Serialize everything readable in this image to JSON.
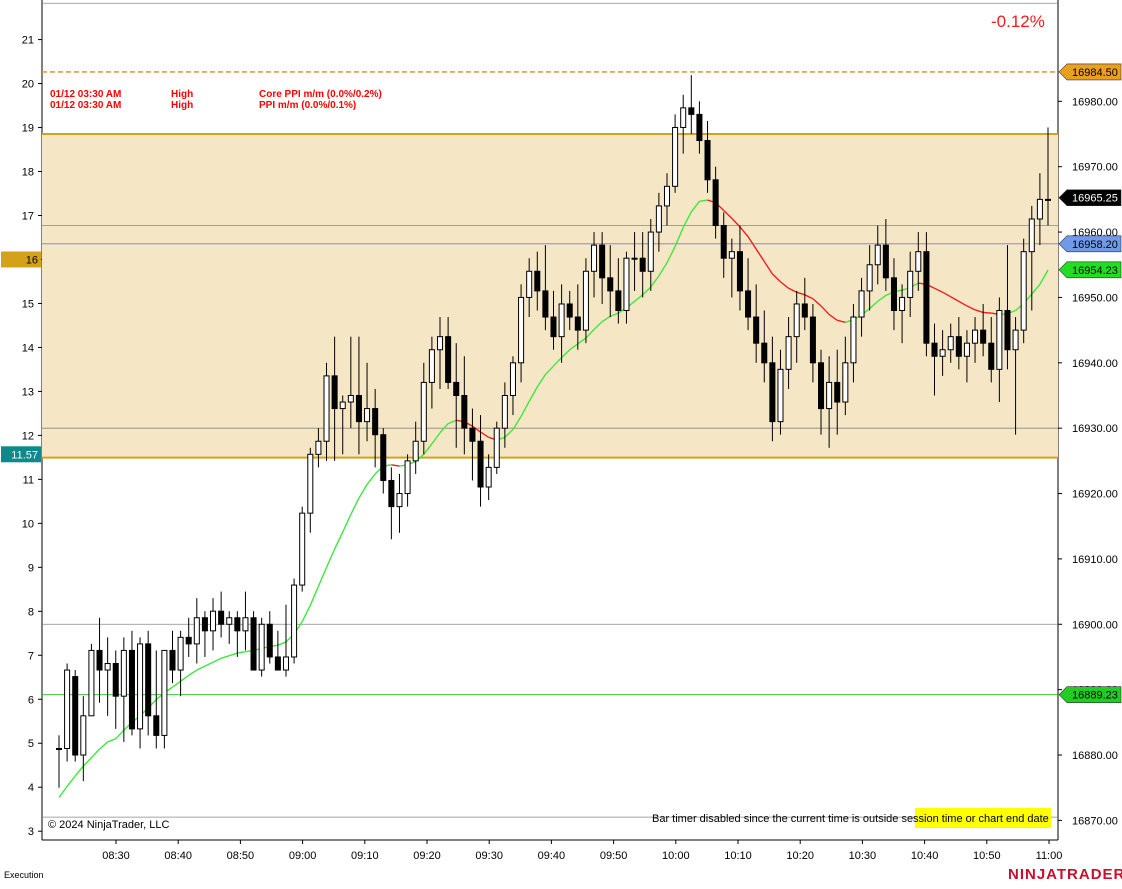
{
  "chart_data": {
    "type": "candlestick",
    "percent_change": "-0.12%",
    "copyright": "© 2024 NinjaTrader, LLC",
    "status_message": "Bar timer disabled since the current time is outside session time or chart end date",
    "status_badge": "Bar timer disabled since the current time is outside session time or chart end date",
    "panel_label": "Execution",
    "brand": "NINJATRADER",
    "x_ticks": [
      "08:30",
      "08:40",
      "08:50",
      "09:00",
      "09:10",
      "09:20",
      "09:30",
      "09:40",
      "09:50",
      "10:00",
      "10:10",
      "10:20",
      "10:30",
      "10:40",
      "10:50",
      "11:00"
    ],
    "left_axis": {
      "ticks": [
        3,
        4,
        5,
        6,
        7,
        8,
        9,
        10,
        11,
        12,
        13,
        14,
        15,
        16,
        17,
        18,
        19,
        20,
        21
      ],
      "range": [
        2.8,
        21.9
      ]
    },
    "right_axis": {
      "ticks": [
        16870,
        16880,
        16890,
        16900,
        16910,
        16920,
        16930,
        16940,
        16950,
        16960,
        16970,
        16980
      ],
      "range": [
        16867.0,
        16995.5
      ]
    },
    "right_tick_labels": [
      "16870.00",
      "16880.00",
      "16890.00",
      "16900.00",
      "16910.00",
      "16920.00",
      "16930.00",
      "16940.00",
      "16950.00",
      "16960.00",
      "16970.00",
      "16980.00"
    ],
    "zone": {
      "top": 16975.0,
      "bottom": 16925.5,
      "fill": "#f5e6c6",
      "border": "#d4a21a"
    },
    "hlines": [
      {
        "price": 16984.5,
        "color": "#e0a030",
        "dash": true
      },
      {
        "price": 16958.2,
        "color": "#6688cc",
        "dash": false
      },
      {
        "price": 16961.0,
        "color": "#888888",
        "dash": false
      },
      {
        "price": 16930.0,
        "color": "#888888",
        "dash": false
      },
      {
        "price": 16900.0,
        "color": "#888888",
        "dash": false
      },
      {
        "price": 16889.23,
        "color": "#22bb22",
        "dash": false
      },
      {
        "price": 16870.5,
        "color": "#888888",
        "dash": false
      },
      {
        "price": 16995.0,
        "color": "#888888",
        "dash": false
      }
    ],
    "right_markers": [
      {
        "label": "16984.50",
        "price": 16984.5,
        "bg": "#e8a020",
        "fg": "#000000"
      },
      {
        "label": "16965.25",
        "price": 16965.25,
        "bg": "#000000",
        "fg": "#ffffff"
      },
      {
        "label": "16958.20",
        "price": 16958.2,
        "bg": "#6f9ae8",
        "fg": "#000000"
      },
      {
        "label": "16954.23",
        "price": 16954.23,
        "bg": "#22dd22",
        "fg": "#000000"
      },
      {
        "label": "16889.23",
        "price": 16889.23,
        "bg": "#22cc22",
        "fg": "#000000"
      }
    ],
    "left_markers": [
      {
        "label": "16",
        "value": 16,
        "bg": "#d4a21a",
        "fg": "#000000"
      },
      {
        "label": "11.57",
        "value": 11.57,
        "bg": "#0e8a8a",
        "fg": "#ffffff"
      }
    ],
    "events": [
      {
        "time": "01/12 03:30 AM",
        "impact": "High",
        "title": "Core PPI m/m (0.0%/0.2%)"
      },
      {
        "time": "01/12 03:30 AM",
        "impact": "High",
        "title": "PPI m/m (0.0%/0.1%)"
      }
    ],
    "candles": [
      [
        16881,
        16883,
        16875,
        16881
      ],
      [
        16881,
        16894,
        16879,
        16893
      ],
      [
        16892,
        16893,
        16879,
        16880
      ],
      [
        16880,
        16889,
        16876,
        16886
      ],
      [
        16886,
        16897,
        16886,
        16896
      ],
      [
        16896,
        16901,
        16888,
        16893
      ],
      [
        16893,
        16898,
        16886,
        16894
      ],
      [
        16894,
        16896,
        16884,
        16889
      ],
      [
        16889,
        16898,
        16882,
        16896
      ],
      [
        16896,
        16899,
        16883,
        16884
      ],
      [
        16884,
        16898,
        16881,
        16897
      ],
      [
        16897,
        16899,
        16883,
        16886
      ],
      [
        16886,
        16896,
        16881,
        16883
      ],
      [
        16883,
        16896,
        16881,
        16896
      ],
      [
        16896,
        16899,
        16891,
        16893
      ],
      [
        16893,
        16899,
        16889,
        16898
      ],
      [
        16898,
        16901,
        16895,
        16897
      ],
      [
        16897,
        16904,
        16894,
        16901
      ],
      [
        16901,
        16902,
        16895,
        16899
      ],
      [
        16899,
        16904,
        16896,
        16902
      ],
      [
        16902,
        16905,
        16898,
        16900
      ],
      [
        16900,
        16902,
        16897,
        16901
      ],
      [
        16901,
        16902,
        16895,
        16899
      ],
      [
        16899,
        16905,
        16896,
        16901
      ],
      [
        16901,
        16902,
        16894,
        16893
      ],
      [
        16893,
        16901,
        16892,
        16900
      ],
      [
        16900,
        16902,
        16894,
        16895
      ],
      [
        16895,
        16899,
        16893,
        16893
      ],
      [
        16893,
        16903,
        16892,
        16895
      ],
      [
        16895,
        16907,
        16894,
        16906
      ],
      [
        16906,
        16918,
        16905,
        16917
      ],
      [
        16917,
        16927,
        16914,
        16926
      ],
      [
        16926,
        16930,
        16924,
        16928
      ],
      [
        16928,
        16940,
        16925,
        16938
      ],
      [
        16938,
        16944,
        16925,
        16933
      ],
      [
        16933,
        16935,
        16926,
        16934
      ],
      [
        16934,
        16944,
        16930,
        16935
      ],
      [
        16935,
        16944,
        16926,
        16931
      ],
      [
        16931,
        16940,
        16928,
        16933
      ],
      [
        16933,
        16936,
        16924,
        16929
      ],
      [
        16929,
        16930,
        16920,
        16922
      ],
      [
        16922,
        16924,
        16913,
        16918
      ],
      [
        16918,
        16923,
        16914,
        16920
      ],
      [
        16920,
        16926,
        16918,
        16925
      ],
      [
        16925,
        16931,
        16923,
        16928
      ],
      [
        16928,
        16940,
        16926,
        16937
      ],
      [
        16937,
        16944,
        16933,
        16942
      ],
      [
        16942,
        16947,
        16936,
        16944
      ],
      [
        16944,
        16947,
        16936,
        16937
      ],
      [
        16937,
        16943,
        16927,
        16935
      ],
      [
        16935,
        16941,
        16926,
        16930
      ],
      [
        16930,
        16933,
        16922,
        16928
      ],
      [
        16928,
        16932,
        16918,
        16921
      ],
      [
        16921,
        16926,
        16919,
        16924
      ],
      [
        16924,
        16931,
        16923,
        16930
      ],
      [
        16930,
        16937,
        16927,
        16935
      ],
      [
        16935,
        16941,
        16932,
        16940
      ],
      [
        16940,
        16952,
        16937,
        16950
      ],
      [
        16950,
        16956,
        16947,
        16954
      ],
      [
        16954,
        16957,
        16948,
        16951
      ],
      [
        16951,
        16958,
        16945,
        16947
      ],
      [
        16947,
        16951,
        16942,
        16944
      ],
      [
        16944,
        16952,
        16940,
        16949
      ],
      [
        16949,
        16951,
        16945,
        16947
      ],
      [
        16947,
        16952,
        16942,
        16945
      ],
      [
        16945,
        16956,
        16943,
        16954
      ],
      [
        16954,
        16960,
        16950,
        16958
      ],
      [
        16958,
        16960,
        16949,
        16953
      ],
      [
        16953,
        16958,
        16947,
        16951
      ],
      [
        16951,
        16956,
        16946,
        16948
      ],
      [
        16948,
        16957,
        16946,
        16956
      ],
      [
        16956,
        16960,
        16951,
        16956
      ],
      [
        16956,
        16960,
        16950,
        16954
      ],
      [
        16954,
        16962,
        16951,
        16960
      ],
      [
        16960,
        16966,
        16957,
        16964
      ],
      [
        16964,
        16969,
        16961,
        16967
      ],
      [
        16967,
        16978,
        16966,
        16976
      ],
      [
        16976,
        16981,
        16972,
        16979
      ],
      [
        16979,
        16984,
        16975,
        16978
      ],
      [
        16978,
        16980,
        16972,
        16974
      ],
      [
        16974,
        16977,
        16966,
        16968
      ],
      [
        16968,
        16970,
        16959,
        16961
      ],
      [
        16961,
        16963,
        16953,
        16956
      ],
      [
        16956,
        16959,
        16950,
        16957
      ],
      [
        16957,
        16961,
        16948,
        16951
      ],
      [
        16951,
        16956,
        16945,
        16947
      ],
      [
        16947,
        16952,
        16940,
        16943
      ],
      [
        16943,
        16948,
        16937,
        16940
      ],
      [
        16940,
        16944,
        16928,
        16931
      ],
      [
        16931,
        16942,
        16929,
        16939
      ],
      [
        16939,
        16947,
        16936,
        16944
      ],
      [
        16944,
        16951,
        16940,
        16949
      ],
      [
        16949,
        16953,
        16945,
        16947
      ],
      [
        16947,
        16949,
        16937,
        16940
      ],
      [
        16940,
        16942,
        16929,
        16933
      ],
      [
        16933,
        16941,
        16927,
        16937
      ],
      [
        16937,
        16942,
        16929,
        16934
      ],
      [
        16934,
        16944,
        16932,
        16940
      ],
      [
        16940,
        16949,
        16937,
        16947
      ],
      [
        16947,
        16953,
        16944,
        16951
      ],
      [
        16951,
        16958,
        16948,
        16955
      ],
      [
        16955,
        16961,
        16952,
        16958
      ],
      [
        16958,
        16962,
        16951,
        16953
      ],
      [
        16953,
        16956,
        16945,
        16948
      ],
      [
        16948,
        16952,
        16943,
        16950
      ],
      [
        16950,
        16957,
        16947,
        16954
      ],
      [
        16954,
        16960,
        16951,
        16957
      ],
      [
        16957,
        16960,
        16941,
        16943
      ],
      [
        16943,
        16946,
        16935,
        16941
      ],
      [
        16941,
        16945,
        16938,
        16942
      ],
      [
        16942,
        16946,
        16940,
        16944
      ],
      [
        16944,
        16947,
        16939,
        16941
      ],
      [
        16941,
        16945,
        16937,
        16943
      ],
      [
        16943,
        16947,
        16940,
        16945
      ],
      [
        16945,
        16949,
        16941,
        16943
      ],
      [
        16943,
        16947,
        16937,
        16939
      ],
      [
        16939,
        16950,
        16934,
        16948
      ],
      [
        16948,
        16958,
        16939,
        16942
      ],
      [
        16942,
        16947,
        16929,
        16945
      ],
      [
        16945,
        16959,
        16943,
        16957
      ],
      [
        16957,
        16964,
        16948,
        16962
      ],
      [
        16962,
        16969,
        16958,
        16965
      ],
      [
        16965,
        16976,
        16961,
        16965
      ]
    ],
    "sma": [
      16873.5,
      16875.2,
      16876.8,
      16878.3,
      16879.6,
      16880.9,
      16882.0,
      16882.5,
      16883.8,
      16885.0,
      16886.0,
      16887.2,
      16888.5,
      16889.5,
      16890.4,
      16891.3,
      16892.2,
      16893.0,
      16893.6,
      16894.2,
      16894.8,
      16895.2,
      16895.6,
      16895.8,
      16896.0,
      16896.3,
      16896.6,
      16896.8,
      16897.3,
      16898.5,
      16900.4,
      16902.9,
      16905.8,
      16908.7,
      16911.5,
      16914.1,
      16916.8,
      16919.3,
      16921.4,
      16923.0,
      16924.2,
      16924.4,
      16924.2,
      16924.4,
      16924.9,
      16926.0,
      16927.6,
      16929.3,
      16930.7,
      16931.2,
      16931.0,
      16930.3,
      16929.4,
      16928.6,
      16928.2,
      16928.6,
      16929.8,
      16931.8,
      16934.1,
      16936.3,
      16938.2,
      16939.5,
      16940.8,
      16942.0,
      16942.9,
      16943.8,
      16945.1,
      16946.3,
      16947.1,
      16947.6,
      16948.4,
      16949.4,
      16950.4,
      16951.6,
      16953.3,
      16955.3,
      16957.8,
      16960.7,
      16963.1,
      16964.7,
      16964.9,
      16964.5,
      16963.3,
      16962.1,
      16960.8,
      16959.3,
      16957.4,
      16955.5,
      16953.6,
      16952.4,
      16951.4,
      16950.8,
      16950.4,
      16949.8,
      16948.7,
      16947.4,
      16946.5,
      16946.2,
      16946.6,
      16947.3,
      16948.3,
      16949.4,
      16950.3,
      16950.9,
      16951.1,
      16951.5,
      16952.2,
      16952.0,
      16951.4,
      16950.8,
      16950.1,
      16949.4,
      16948.7,
      16948.1,
      16947.7,
      16947.6,
      16947.4,
      16947.5,
      16948.0,
      16949.1,
      16950.5,
      16952.0,
      16954.2
    ]
  }
}
